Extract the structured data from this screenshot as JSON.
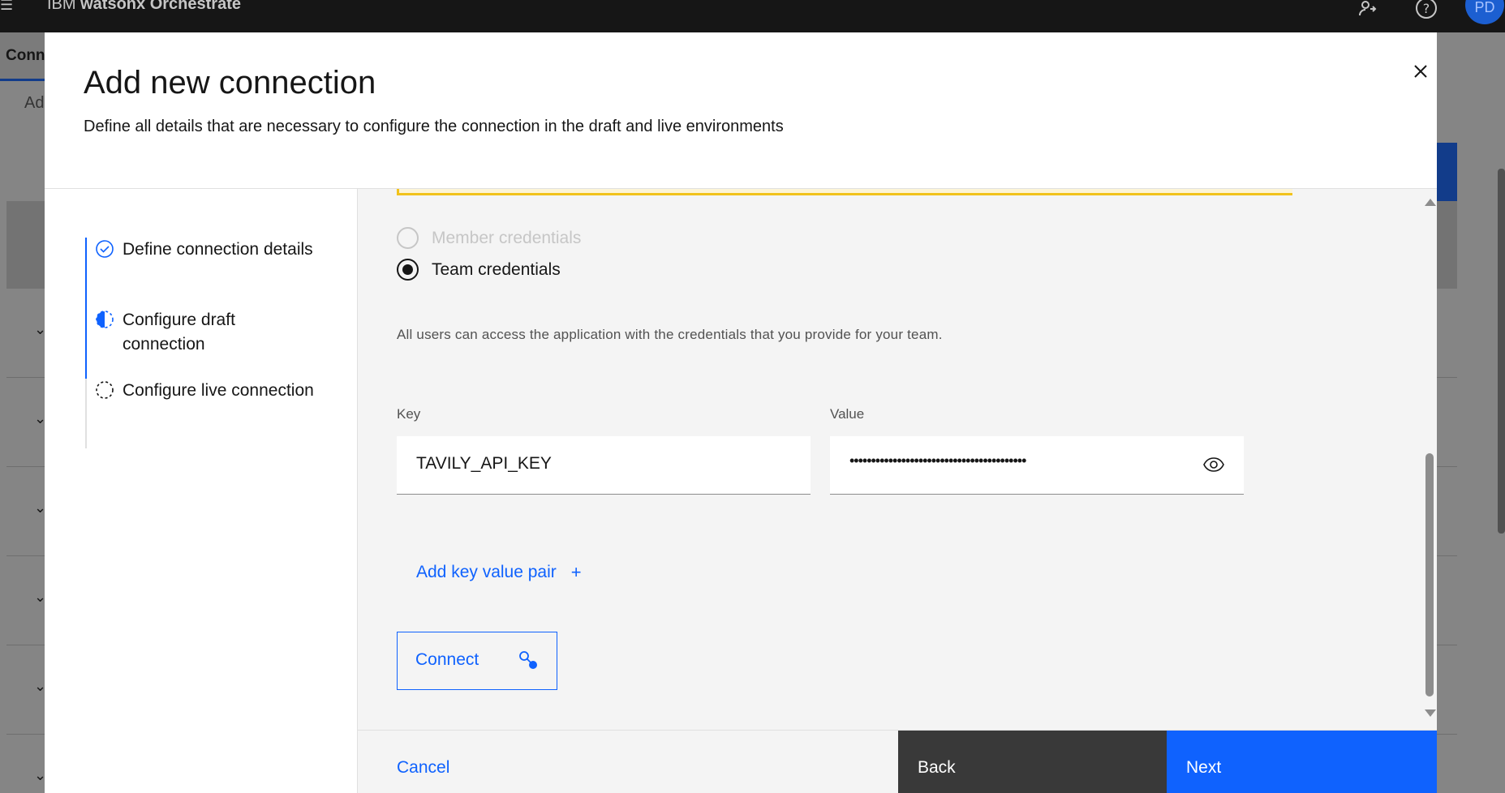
{
  "app": {
    "brand_prefix": "IBM",
    "brand_name": "watsonx Orchestrate",
    "user_initials": "PD",
    "icons": [
      "menu-icon",
      "switch-tenant-icon",
      "help-icon"
    ]
  },
  "background": {
    "tab_label": "Conn",
    "subtitle": "Ad"
  },
  "modal": {
    "title": "Add new connection",
    "description": "Define all details that are necessary to configure the connection in the draft and live environments",
    "steps": [
      {
        "label": "Define connection details",
        "state": "complete"
      },
      {
        "label": "Configure draft connection",
        "state": "current"
      },
      {
        "label": "Configure live connection",
        "state": "incomplete"
      }
    ],
    "credentials": {
      "member_label": "Member credentials",
      "team_label": "Team credentials",
      "selected": "team",
      "helper_text": "All users can access the application with the credentials that you provide for your team."
    },
    "key_value": {
      "key_label": "Key",
      "value_label": "Value",
      "key_value": "TAVILY_API_KEY",
      "value_masked": "•••••••••••••••••••••••••••••••••••••••••"
    },
    "add_pair_label": "Add key value pair",
    "connect_label": "Connect",
    "footer": {
      "cancel": "Cancel",
      "back": "Back",
      "next": "Next"
    }
  },
  "colors": {
    "primary": "#0f62fe",
    "dark": "#393939",
    "header_bg": "#161616",
    "warning": "#f1c21b"
  }
}
